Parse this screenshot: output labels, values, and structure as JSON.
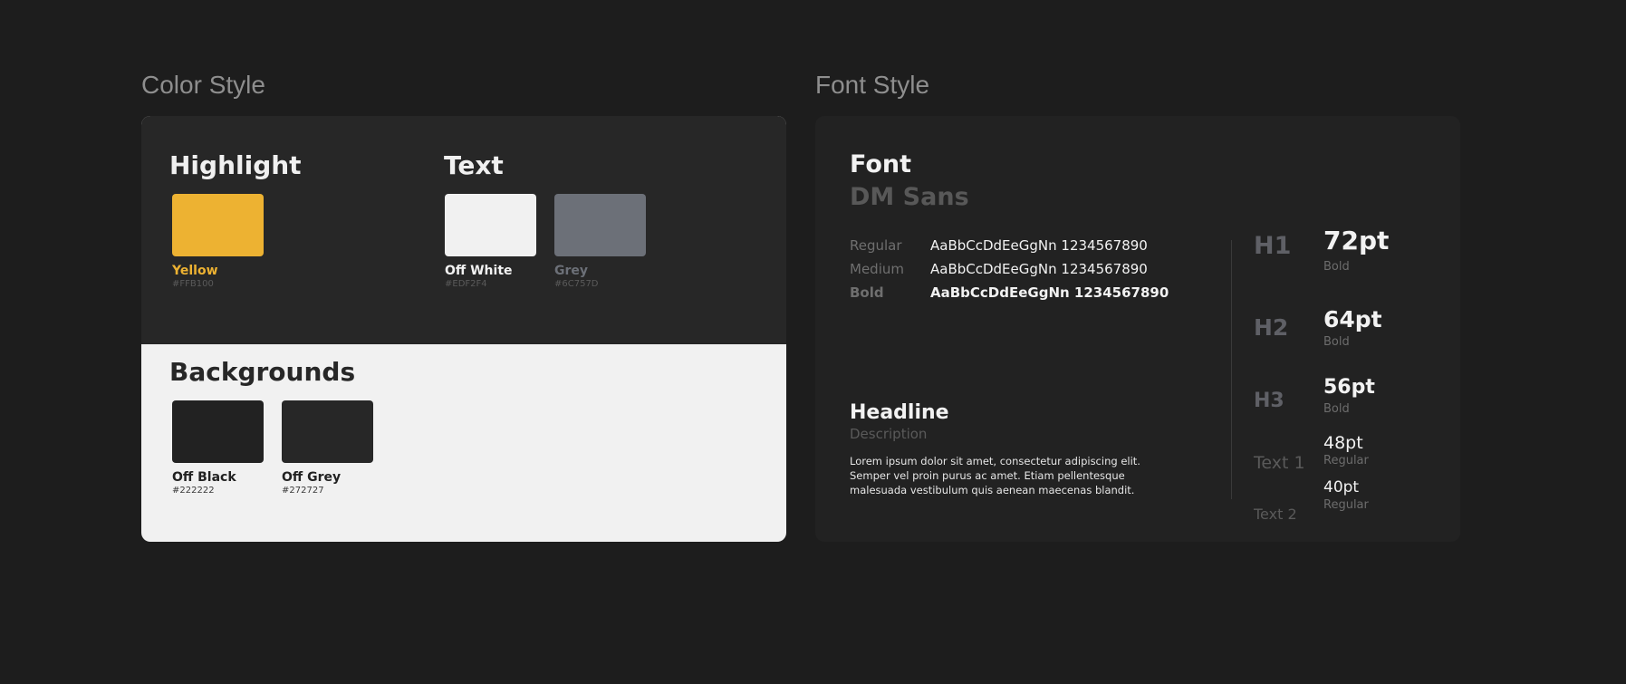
{
  "color_style": {
    "title": "Color Style",
    "highlight": {
      "heading": "Highlight",
      "swatches": [
        {
          "name": "Yellow",
          "hex": "#FFB100",
          "color": "#EDB232",
          "label_color": "#EDB232"
        }
      ]
    },
    "text": {
      "heading": "Text",
      "swatches": [
        {
          "name": "Off White",
          "hex": "#EDF2F4",
          "color": "#F1F1F1",
          "label_color": "#F2F2F2"
        },
        {
          "name": "Grey",
          "hex": "#6C757D",
          "color": "#6C7078",
          "label_color": "#6C7078"
        }
      ]
    },
    "backgrounds": {
      "heading": "Backgrounds",
      "swatches": [
        {
          "name": "Off Black",
          "hex": "#222222",
          "color": "#222222",
          "label_color": "#222222"
        },
        {
          "name": "Off Grey",
          "hex": "#272727",
          "color": "#272727",
          "label_color": "#222222"
        }
      ]
    }
  },
  "font_style": {
    "title": "Font Style",
    "font_heading": "Font",
    "font_name": "DM Sans",
    "weights": [
      {
        "label": "Regular",
        "sample": "AaBbCcDdEeGgNn 1234567890"
      },
      {
        "label": "Medium",
        "sample": "AaBbCcDdEeGgNn 1234567890"
      },
      {
        "label": "Bold",
        "sample": "AaBbCcDdEeGgNn 1234567890"
      }
    ],
    "headline": "Headline",
    "description": "Description",
    "body_lines": [
      "Lorem ipsum dolor sit amet, consectetur adipiscing elit.",
      "Semper vel proin purus ac amet. Etiam pellentesque",
      "malesuada vestibulum quis aenean maecenas blandit."
    ],
    "type_scale": [
      {
        "label": "H1",
        "size": "72pt",
        "weight": "Bold"
      },
      {
        "label": "H2",
        "size": "64pt",
        "weight": "Bold"
      },
      {
        "label": "H3",
        "size": "56pt",
        "weight": "Bold"
      },
      {
        "label": "Text 1",
        "size": "48pt",
        "weight": "Regular"
      },
      {
        "label": "Text 2",
        "size": "40pt",
        "weight": "Regular"
      }
    ]
  }
}
